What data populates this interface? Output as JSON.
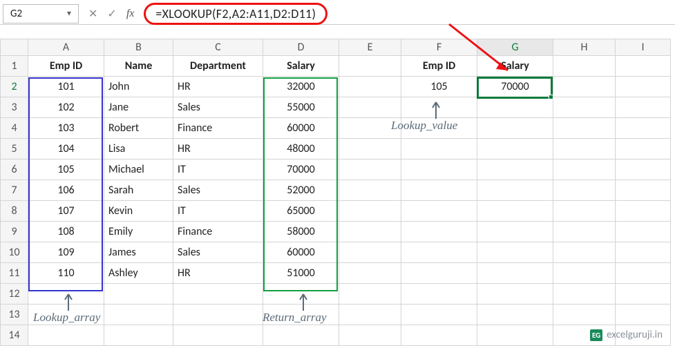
{
  "name_box": "G2",
  "formula": "=XLOOKUP(F2,A2:A11,D2:D11)",
  "col_headers": [
    "A",
    "B",
    "C",
    "D",
    "E",
    "F",
    "G",
    "H",
    "I"
  ],
  "row_headers": [
    "1",
    "2",
    "3",
    "4",
    "5",
    "6",
    "7",
    "8",
    "9",
    "10",
    "11",
    "12",
    "13",
    "14"
  ],
  "table_headers": {
    "A": "Emp ID",
    "B": "Name",
    "C": "Department",
    "D": "Salary"
  },
  "rows": [
    {
      "id": "101",
      "name": "John",
      "dept": "HR",
      "sal": "32000"
    },
    {
      "id": "102",
      "name": "Jane",
      "dept": "Sales",
      "sal": "55000"
    },
    {
      "id": "103",
      "name": "Robert",
      "dept": "Finance",
      "sal": "60000"
    },
    {
      "id": "104",
      "name": "Lisa",
      "dept": "HR",
      "sal": "48000"
    },
    {
      "id": "105",
      "name": "Michael",
      "dept": "IT",
      "sal": "70000"
    },
    {
      "id": "106",
      "name": "Sarah",
      "dept": "Sales",
      "sal": "52000"
    },
    {
      "id": "107",
      "name": "Kevin",
      "dept": "IT",
      "sal": "65000"
    },
    {
      "id": "108",
      "name": "Emily",
      "dept": "Finance",
      "sal": "58000"
    },
    {
      "id": "109",
      "name": "James",
      "dept": "Sales",
      "sal": "60000"
    },
    {
      "id": "110",
      "name": "Ashley",
      "dept": "HR",
      "sal": "51000"
    }
  ],
  "lookup_headers": {
    "F": "Emp ID",
    "G": "Salary"
  },
  "lookup_row": {
    "F": "105",
    "G": "70000"
  },
  "annotations": {
    "lookup_array": "Lookup_array",
    "return_array": "Return_array",
    "lookup_value": "Lookup_value"
  },
  "watermark": {
    "badge": "EG",
    "text": "excelguruji.in"
  }
}
